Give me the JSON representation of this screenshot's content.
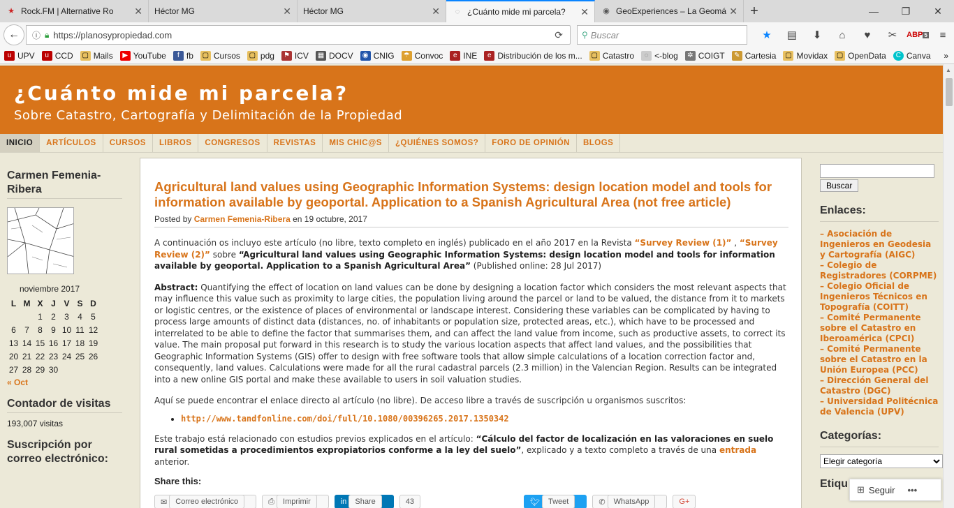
{
  "browser": {
    "tabs": [
      {
        "title": "Rock.FM | Alternative Ro",
        "icon": "star-icon"
      },
      {
        "title": "Héctor MG",
        "icon": "blank-icon"
      },
      {
        "title": "Héctor MG",
        "icon": "blank-icon"
      },
      {
        "title": "¿Cuánto mide mi parcela?",
        "icon": "site-icon",
        "active": true
      },
      {
        "title": "GeoExperiences – La Geomá",
        "icon": "globe-icon"
      }
    ],
    "url": "https://planosypropiedad.com",
    "search_placeholder": "Buscar",
    "badge_count": "5",
    "bookmarks": [
      "UPV",
      "CCD",
      "Mails",
      "YouTube",
      "fb",
      "Cursos",
      "pdg",
      "ICV",
      "DOCV",
      "CNIG",
      "Convoc",
      "INE",
      "Distribución de los m...",
      "Catastro",
      "<-blog",
      "COIGT",
      "Cartesia",
      "Movidax",
      "OpenData",
      "Canva"
    ]
  },
  "site": {
    "title": "¿Cuánto mide mi parcela?",
    "subtitle": "Sobre Catastro, Cartografía y Delimitación de la Propiedad",
    "accent": "#d8741a",
    "menu": [
      "INICIO",
      "ARTÍCULOS",
      "CURSOS",
      "LIBROS",
      "CONGRESOS",
      "REVISTAS",
      "MIS CHIC@S",
      "¿QUIÉNES SOMOS?",
      "FORO DE OPINIÓN",
      "BLOGS"
    ]
  },
  "left": {
    "author_heading": "Carmen Femenia-Ribera",
    "calendar": {
      "caption": "noviembre 2017",
      "days": [
        "L",
        "M",
        "X",
        "J",
        "V",
        "S",
        "D"
      ],
      "weeks": [
        [
          "",
          "",
          "1",
          "2",
          "3",
          "4",
          "5"
        ],
        [
          "6",
          "7",
          "8",
          "9",
          "10",
          "11",
          "12"
        ],
        [
          "13",
          "14",
          "15",
          "16",
          "17",
          "18",
          "19"
        ],
        [
          "20",
          "21",
          "22",
          "23",
          "24",
          "25",
          "26"
        ],
        [
          "27",
          "28",
          "29",
          "30",
          "",
          "",
          ""
        ]
      ],
      "prev": "« Oct"
    },
    "counter_heading": "Contador de visitas",
    "visits": "193,007 visitas",
    "subscribe_heading": "Suscripción por correo electrónico:"
  },
  "post": {
    "title": "Agricultural land values using Geographic Information Systems: design location model and tools for information available by geoportal. Application to a Spanish Agricultural Area (not free article)",
    "posted_prefix": "Posted by",
    "author": "Carmen Femenia-Ribera",
    "date": "en 19 octubre, 2017",
    "intro_a": "A continuación os incluyo este artículo (no libre, texto completo en inglés) publicado en el año 2017 en la Revista ",
    "link1": "“Survey Review (1)”",
    "sep": " , ",
    "link2": "“Survey Review (2)”",
    "intro_b": " sobre ",
    "intro_title": "“Agricultural land values using Geographic Information Systems: design location model and tools for information available by geoportal. Application to a Spanish Agricultural Area”",
    "intro_c": " (Published online: 28 Jul 2017)",
    "abstract_label": "Abstract:",
    "abstract": " Quantifying the effect of location on land values can be done by designing a location factor which considers the most relevant aspects that may influence this value such as proximity to large cities, the population living around the parcel or land to be valued, the distance from it to markets or logistic centres, or the existence of places of environmental or landscape interest. Considering these variables can be complicated by having to process large amounts of distinct data (distances, no. of inhabitants or population size, protected areas, etc.), which have to be processed and interrelated to be able to define the factor that summarises them, and can affect the land value from income, such as productive assets, to correct its value. The main proposal put forward in this research is to study the various location aspects that affect land values, and the possibilities that Geographic Information Systems (GIS) offer to design with free software tools that allow simple calculations of a location correction factor and, consequently, land values. Calculations were made for all the rural cadastral parcels (2.3 million) in the Valencian Region. Results can be integrated into a new online GIS portal and make these available to users in soil valuation studies.",
    "access": "Aquí se puede encontrar el enlace directo al artículo (no libre). De acceso libre a través de suscripción u organismos suscritos:",
    "doi_link": "http://www.tandfonline.com/doi/full/10.1080/00396265.2017.1350342",
    "related_a": "Este trabajo está relacionado con estudios previos explicados en el artículo: ",
    "related_title": "“Cálculo del factor de localización en las valoraciones en suelo rural sometidas a procedimientos expropiatorios conforme a la ley del suelo”",
    "related_b": ",  explicado y a texto completo a través de una ",
    "related_link": "entrada",
    "related_c": " anterior.",
    "share_heading": "Share this:",
    "share_buttons": [
      "Correo electrónico",
      "Imprimir",
      "Share",
      "43",
      "Tweet",
      "WhatsApp",
      "G+"
    ]
  },
  "right": {
    "search_button": "Buscar",
    "links_heading": "Enlaces:",
    "links": [
      "– Asociación de Ingenieros en Geodesia y Cartografía (AIGC)",
      "– Colegio de Registradores (CORPME)",
      "– Colegio Oficial de Ingenieros Técnicos en Topografía (COITT)",
      "– Comité Permanente sobre el Catastro en Iberoamérica (CPCI)",
      "– Comité Permanente sobre el Catastro en la Unión Europea (PCC)",
      "– Dirección General del Catastro (DGC)",
      "– Universidad Politécnica de Valencia (UPV)"
    ],
    "categories_heading": "Categorías:",
    "categories_select": "Elegir categoría",
    "tags_heading": "Etiqu"
  },
  "follow_label": "Seguir"
}
